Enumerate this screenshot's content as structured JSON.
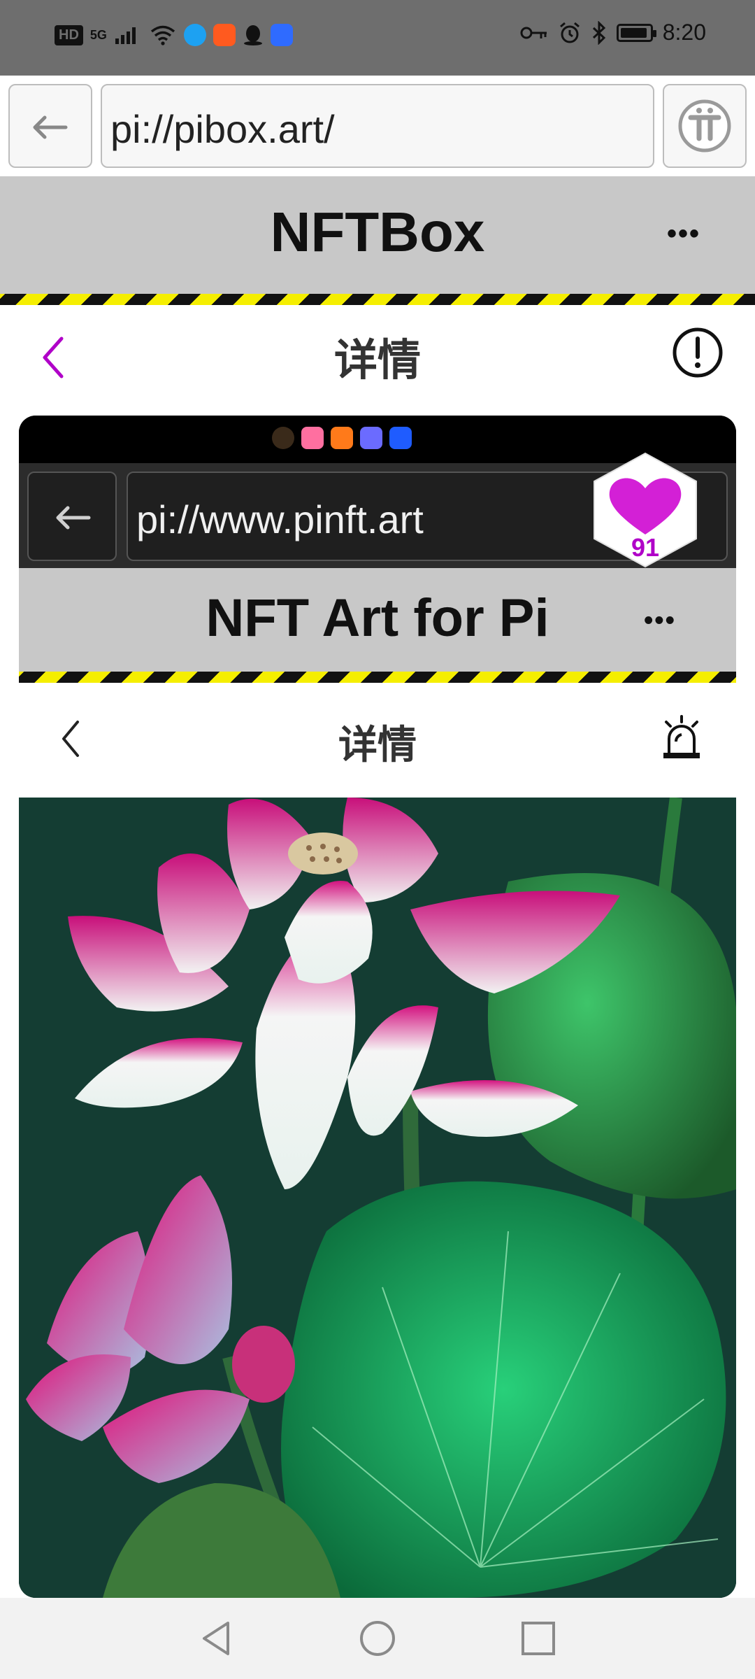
{
  "status_bar": {
    "left_indicators": [
      "HD",
      "5G"
    ],
    "time": "8:20",
    "icons": [
      "signal-icon",
      "wifi-icon",
      "app-notification-icons",
      "key-icon",
      "alarm-icon",
      "bluetooth-icon",
      "battery-icon"
    ],
    "battery_level": 0.9
  },
  "browser": {
    "url": "pi://pibox.art/",
    "back_icon": "arrow-left-icon",
    "pi_icon": "pi-logo-icon"
  },
  "app_header": {
    "title": "NFTBox",
    "menu_label": "•••"
  },
  "subheader": {
    "title": "详情",
    "back_icon": "chevron-left-icon",
    "info_icon": "exclamation-circle-icon"
  },
  "screenshot_card": {
    "url": "pi://www.pinft.art",
    "header_title": "NFT Art for Pi",
    "menu_label": "•••",
    "sub_title": "详情",
    "alarm_icon": "siren-icon",
    "image_subject": "lotus-flowers-artwork"
  },
  "like_badge": {
    "count": "91",
    "icon": "heart-icon"
  },
  "colors": {
    "accent_purple": "#b000c8",
    "heart_magenta": "#d320d6",
    "hazard_yellow": "#f5ee00",
    "header_gray": "#c8c8c8"
  },
  "nav_bar": {
    "icons": [
      "back-triangle-icon",
      "home-circle-icon",
      "recents-square-icon"
    ]
  }
}
